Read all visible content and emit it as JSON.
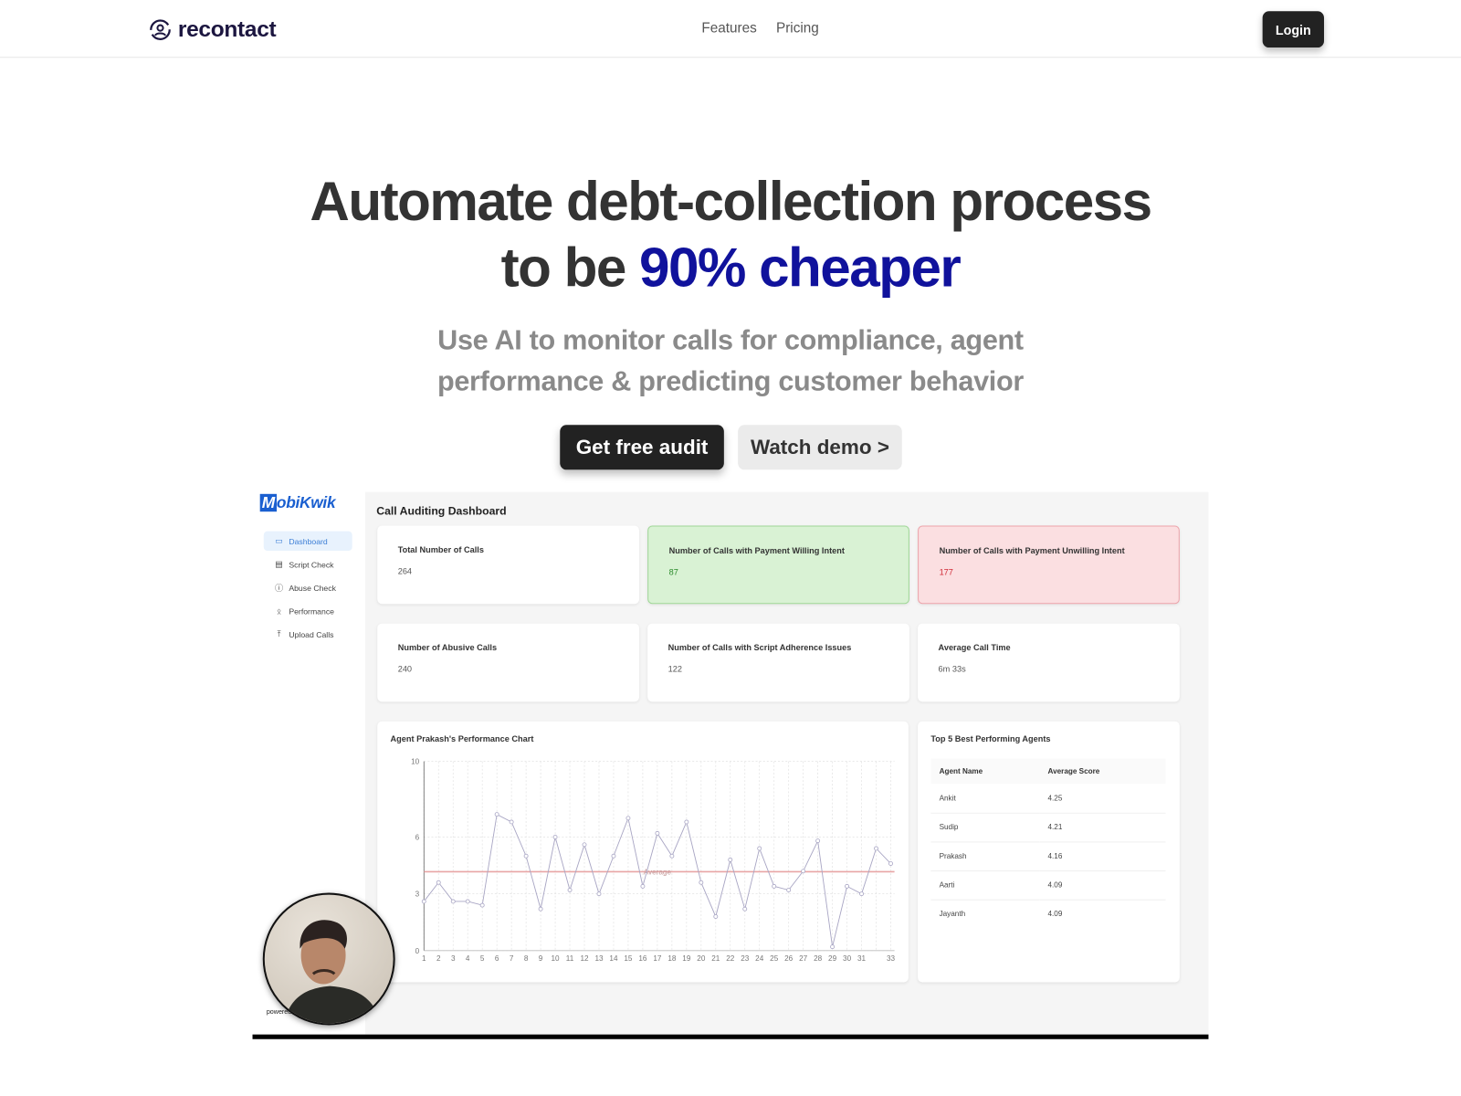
{
  "nav": {
    "brand": "recontact",
    "links": [
      "Features",
      "Pricing"
    ],
    "login": "Login"
  },
  "hero": {
    "line1": "Automate debt-collection process",
    "line2_prefix": "to be ",
    "line2_accent": "90% cheaper",
    "subtitle_line1": "Use AI to monitor calls for compliance, agent",
    "subtitle_line2": "performance & predicting customer behavior",
    "cta_primary": "Get free audit",
    "cta_secondary": "Watch demo >",
    "accent_color": "#10129c"
  },
  "dashboard": {
    "brand": "MobiKwik",
    "sidebar": [
      {
        "label": "Dashboard",
        "icon": "monitor-icon",
        "active": true
      },
      {
        "label": "Script Check",
        "icon": "document-icon"
      },
      {
        "label": "Abuse Check",
        "icon": "alert-circle-icon"
      },
      {
        "label": "Performance",
        "icon": "users-icon"
      },
      {
        "label": "Upload Calls",
        "icon": "upload-icon"
      }
    ],
    "title": "Call Auditing Dashboard",
    "stats": [
      {
        "label": "Total Number of Calls",
        "value": "264",
        "tone": "neutral"
      },
      {
        "label": "Number of Calls with Payment Willing Intent",
        "value": "87",
        "tone": "green"
      },
      {
        "label": "Number of Calls with Payment Unwilling Intent",
        "value": "177",
        "tone": "red"
      },
      {
        "label": "Number of Abusive Calls",
        "value": "240",
        "tone": "neutral"
      },
      {
        "label": "Number of Calls with Script Adherence Issues",
        "value": "122",
        "tone": "neutral"
      },
      {
        "label": "Average Call Time",
        "value": "6m 33s",
        "tone": "neutral"
      }
    ],
    "top_agents": {
      "title": "Top 5 Best Performing Agents",
      "headers": [
        "Agent Name",
        "Average Score"
      ],
      "rows": [
        [
          "Ankit",
          "4.25"
        ],
        [
          "Sudip",
          "4.21"
        ],
        [
          "Prakash",
          "4.16"
        ],
        [
          "Aarti",
          "4.09"
        ],
        [
          "Jayanth",
          "4.09"
        ]
      ]
    },
    "video_caption": "powered"
  },
  "chart_data": {
    "type": "line",
    "title": "Agent Prakash's Performance Chart",
    "x": [
      1,
      2,
      3,
      4,
      5,
      6,
      7,
      8,
      9,
      10,
      11,
      12,
      13,
      14,
      15,
      16,
      17,
      18,
      19,
      20,
      21,
      22,
      23,
      24,
      25,
      26,
      27,
      28,
      29,
      30,
      31,
      32,
      33
    ],
    "x_tick_labels": [
      "1",
      "2",
      "3",
      "4",
      "5",
      "6",
      "7",
      "8",
      "9",
      "10",
      "11",
      "12",
      "13",
      "14",
      "15",
      "16",
      "17",
      "18",
      "19",
      "20",
      "21",
      "22",
      "23",
      "24",
      "25",
      "26",
      "27",
      "28",
      "29",
      "30",
      "31",
      "",
      "33"
    ],
    "values": [
      2.6,
      3.6,
      2.6,
      2.6,
      2.4,
      7.2,
      6.8,
      5.0,
      2.2,
      6.0,
      3.2,
      5.6,
      3.0,
      5.0,
      7.0,
      3.4,
      6.2,
      5.0,
      6.8,
      3.6,
      1.8,
      4.8,
      2.2,
      5.4,
      3.4,
      3.2,
      4.2,
      5.8,
      0.2,
      3.4,
      3.0,
      5.4,
      4.6
    ],
    "y_ticks": [
      0,
      3,
      6,
      10
    ],
    "ylim": [
      0,
      10
    ],
    "reference_line": {
      "label": "Average",
      "value": 4.17,
      "color": "#e8a5a5"
    },
    "line_color": "#a9a6c4",
    "grid": true
  }
}
